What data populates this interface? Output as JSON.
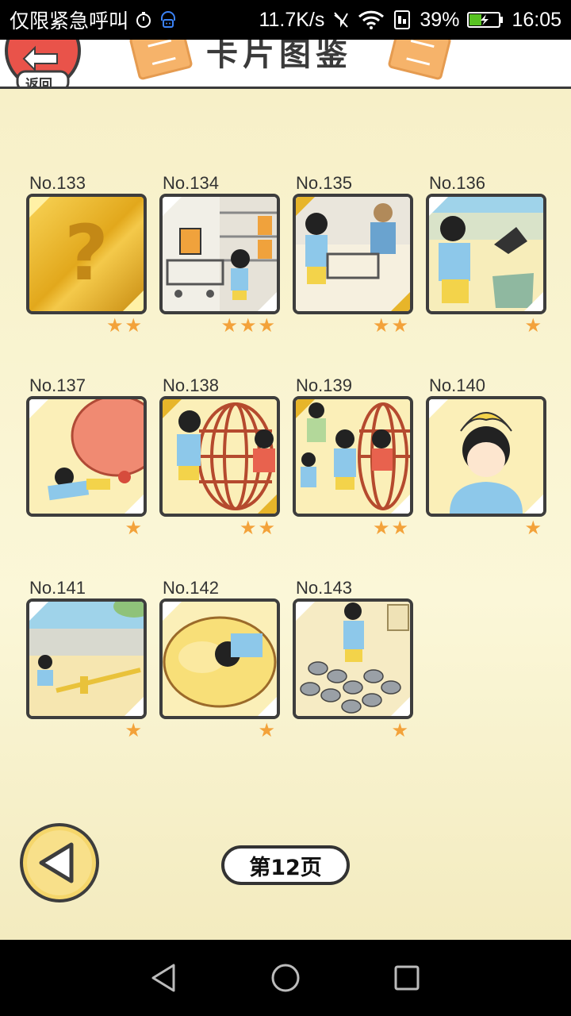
{
  "status_bar": {
    "carrier": "仅限紧急呼叫",
    "speed": "11.7K/s",
    "battery": "39%",
    "time": "16:05"
  },
  "header": {
    "title": "卡片图鉴",
    "back_label": "返回"
  },
  "cards": [
    {
      "no": "No.133",
      "stars": "★★"
    },
    {
      "no": "No.134",
      "stars": "★★★"
    },
    {
      "no": "No.135",
      "stars": "★★"
    },
    {
      "no": "No.136",
      "stars": "★"
    },
    {
      "no": "No.137",
      "stars": "★"
    },
    {
      "no": "No.138",
      "stars": "★★"
    },
    {
      "no": "No.139",
      "stars": "★★"
    },
    {
      "no": "No.140",
      "stars": "★"
    },
    {
      "no": "No.141",
      "stars": "★"
    },
    {
      "no": "No.142",
      "stars": "★"
    },
    {
      "no": "No.143",
      "stars": "★"
    }
  ],
  "pagination": {
    "page_label": "第12页"
  },
  "colors": {
    "accent": "#f3a23a",
    "gold": "#e7b52a",
    "prev_button": "#f5d66b"
  }
}
